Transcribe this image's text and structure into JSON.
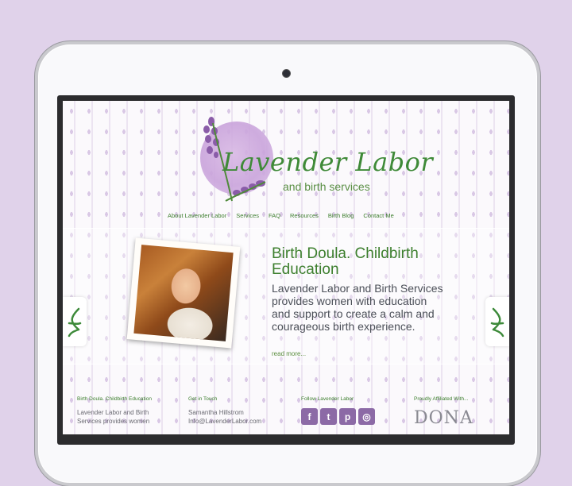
{
  "site": {
    "logo_title": "Lavender Labor",
    "logo_subtitle": "and birth services"
  },
  "nav": {
    "items": [
      "About Lavender Labor",
      "Services",
      "FAQ",
      "Resources",
      "Birth Blog",
      "Contact Me"
    ]
  },
  "hero": {
    "title": "Birth Doula. Childbirth Education",
    "text": "Lavender Labor and Birth Services provides women with education and support to create a calm and courageous birth experience.",
    "read_more": "read more..."
  },
  "footer": {
    "col1_head": "Birth Doula. Childbirth Education",
    "col1_text": "Lavender Labor and Birth Services provides women",
    "col2_head": "Get in Touch",
    "col2_name": "Samantha Hillstrom",
    "col2_email": "Info@LavenderLabor.com",
    "col3_head": "Follow Lavender Labor",
    "col4_head": "Proudly Affiliated With...",
    "col4_logo_text": "DONA"
  },
  "colors": {
    "background": "#e0d2ea",
    "accent_green": "#3d7f2e",
    "lavender": "#c9a3db"
  }
}
